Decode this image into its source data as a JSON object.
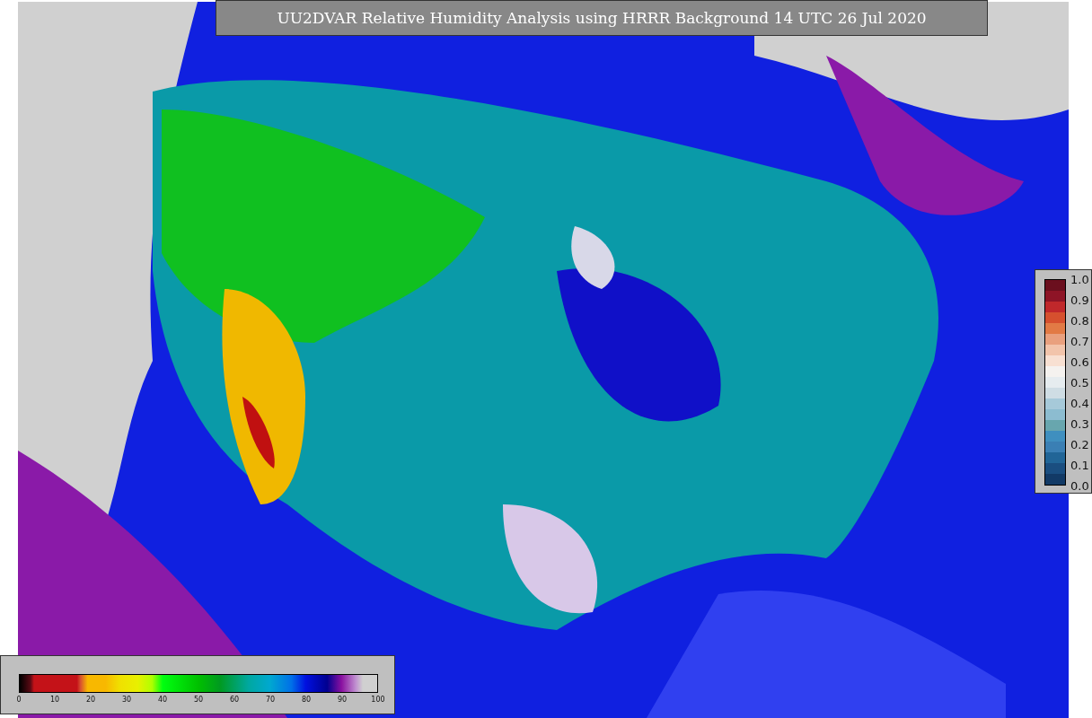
{
  "title": "UU2DVAR Relative Humidity Analysis using HRRR Background 14 UTC 26 Jul 2020",
  "humidity_colorbar": {
    "ticks": [
      "0",
      "10",
      "20",
      "30",
      "40",
      "50",
      "60",
      "70",
      "80",
      "90",
      "100"
    ]
  },
  "observation_colorbar": {
    "ticks": [
      "1.0",
      "0.9",
      "0.8",
      "0.7",
      "0.6",
      "0.5",
      "0.4",
      "0.3",
      "0.2",
      "0.1",
      "0.0"
    ]
  }
}
